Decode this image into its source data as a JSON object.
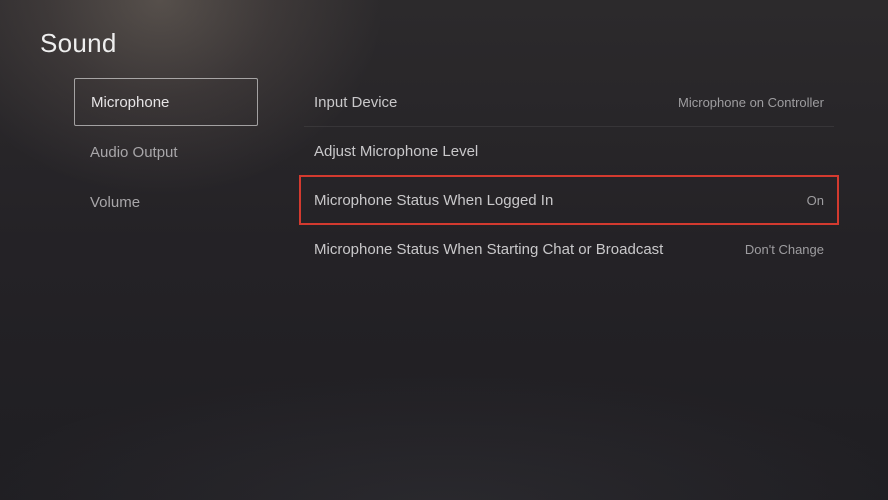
{
  "title": "Sound",
  "sidebar": {
    "items": [
      {
        "label": "Microphone",
        "selected": true
      },
      {
        "label": "Audio Output",
        "selected": false
      },
      {
        "label": "Volume",
        "selected": false
      }
    ]
  },
  "settings": {
    "rows": [
      {
        "label": "Input Device",
        "value": "Microphone on Controller",
        "highlight": false
      },
      {
        "label": "Adjust Microphone Level",
        "value": "",
        "highlight": false
      },
      {
        "label": "Microphone Status When Logged In",
        "value": "On",
        "highlight": true
      },
      {
        "label": "Microphone Status When Starting Chat or Broadcast",
        "value": "Don't Change",
        "highlight": false
      }
    ]
  },
  "colors": {
    "highlight_border": "#d33a2f"
  }
}
